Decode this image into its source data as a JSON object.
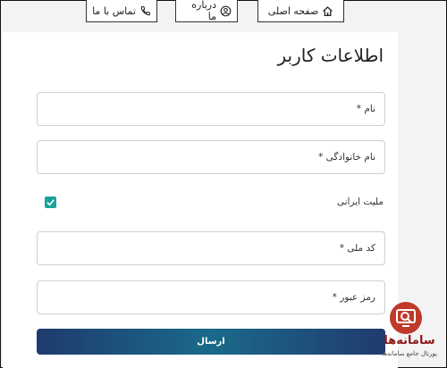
{
  "nav": {
    "home_label": "صفحه اصلی",
    "about_label": "درباره ما",
    "contact_label": "تماس با ما"
  },
  "form": {
    "title": "اطلاعات کاربر",
    "fields": {
      "name_placeholder": "نام *",
      "family_placeholder": "نام خانوادگی *",
      "nationality_label": "ملیت ایرانی",
      "nationality_checked": true,
      "national_code_placeholder": "کد ملی *",
      "password_placeholder": "رمز عبور *"
    },
    "submit_label": "ارسال"
  },
  "watermark": {
    "brand": "سامانه‌ها",
    "tagline": "پورتال جامع سامانه‌ها"
  },
  "colors": {
    "checkbox": "#1aa39a",
    "submit_gradient_start": "#1f3a6e",
    "submit_gradient_mid": "#1a6a8a",
    "watermark_red": "#c0392b"
  },
  "icons": {
    "home": "home-icon",
    "about": "user-circle-icon",
    "contact": "phone-icon"
  }
}
